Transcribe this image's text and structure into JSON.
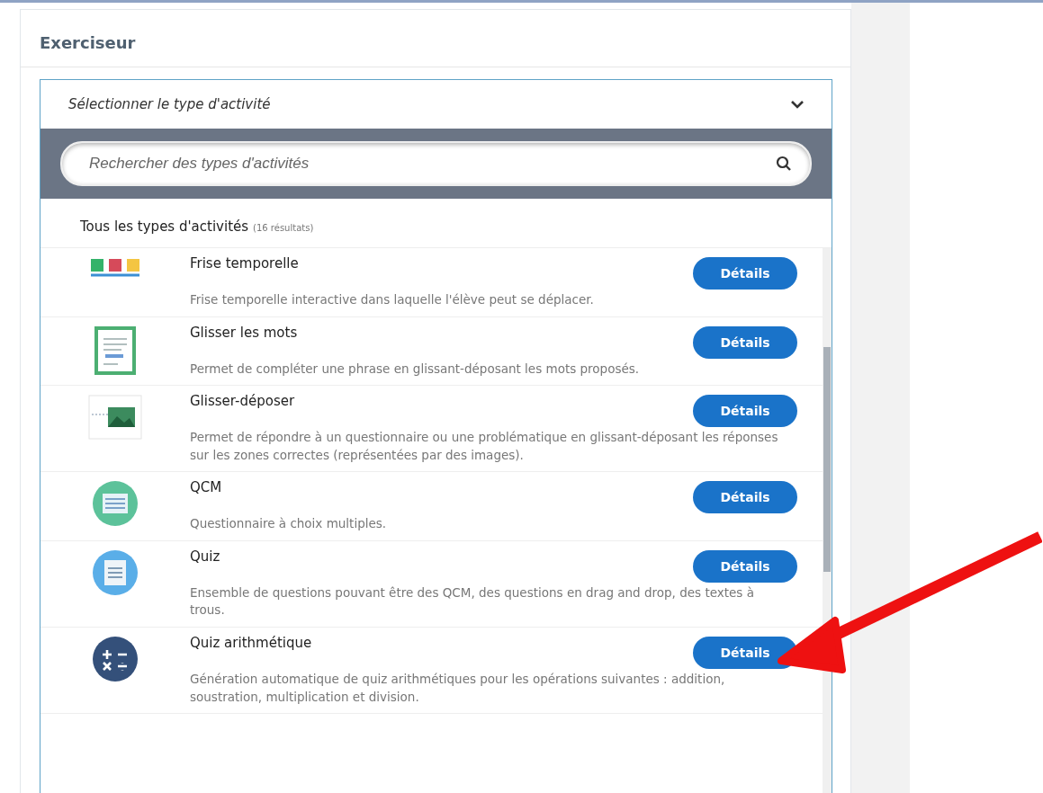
{
  "panel": {
    "title": "Exerciseur"
  },
  "dropdown": {
    "label": "Sélectionner le type d'activité",
    "expanded": true
  },
  "search": {
    "placeholder": "Rechercher des types d'activités"
  },
  "list_header": {
    "label": "Tous les types d'activités",
    "count": "(16 résultats)"
  },
  "activities": [
    {
      "kind": "timeline",
      "title": "Frise temporelle",
      "description": "Frise temporelle interactive dans laquelle l'élève peut se déplacer.",
      "button": "Détails"
    },
    {
      "kind": "words",
      "title": "Glisser les mots",
      "description": "Permet de compléter une phrase en glissant-déposant les mots proposés.",
      "button": "Détails"
    },
    {
      "kind": "dragdrop",
      "title": "Glisser-déposer",
      "description": "Permet de répondre à un questionnaire ou une problématique en glissant-déposant les réponses sur les zones correctes (représentées par des images).",
      "button": "Détails"
    },
    {
      "kind": "qcm",
      "title": "QCM",
      "description": "Questionnaire à choix multiples.",
      "button": "Détails"
    },
    {
      "kind": "quiz",
      "title": "Quiz",
      "description": "Ensemble de questions pouvant être des QCM, des questions en drag and drop, des textes à trous.",
      "button": "Détails"
    },
    {
      "kind": "arith",
      "title": "Quiz arithmétique",
      "description": "Génération automatique de quiz arithmétiques pour les opérations suivantes : addition, soustration, multiplication et division.",
      "button": "Détails"
    }
  ]
}
